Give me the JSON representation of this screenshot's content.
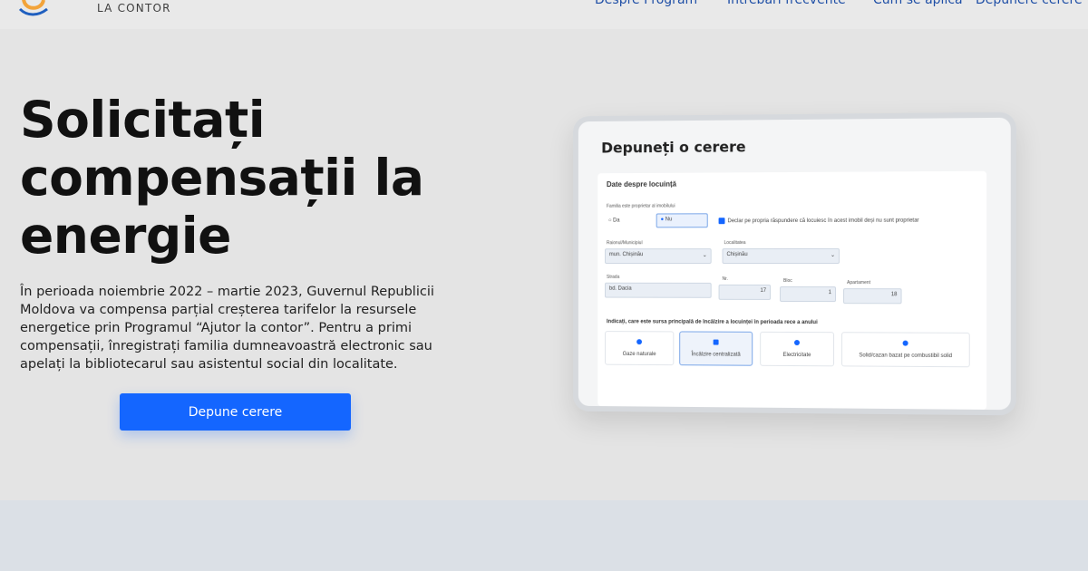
{
  "brand": {
    "logo_text": "LA CONTOR"
  },
  "nav": {
    "items": [
      "Despre Program",
      "Întrebări frecvente",
      "Cum se aplică",
      "Depunere cerere"
    ]
  },
  "hero": {
    "title": "Solicitați compensații la energie",
    "intro": "În perioada noiembrie 2022 – martie 2023, Guvernul Republicii Moldova va compensa parțial creșterea tarifelor la resursele energetice prin Programul “Ajutor la contor”. Pentru a primi compensații, înregistrați familia dumneavoastră electronic sau apelați la bibliotecarul sau asistentul social din localitate.",
    "cta_label": "Depune cerere"
  },
  "mockup": {
    "title": "Depuneți o cerere",
    "section_title": "Date despre locuință",
    "owner_question": "Familia este proprietar al imobilului",
    "owner_yes": "Da",
    "owner_no": "Nu",
    "declaration": "Declar pe propria răspundere că locuiesc în acest imobil deși nu sunt proprietar",
    "raion_label": "Raionul/Municipiul",
    "raion_value": "mun. Chișinău",
    "localitate_label": "Localitatea",
    "localitate_value": "Chișinău",
    "strada_label": "Strada",
    "strada_value": "bd. Dacia",
    "nr_label": "Nr.",
    "nr_value": "17",
    "bloc_label": "Bloc",
    "bloc_value": "1",
    "apartament_label": "Apartament",
    "apartament_value": "18",
    "heating_question": "Indicați, care este sursa principală de încălzire a locuinței în perioada rece a anului",
    "options": [
      "Gaze naturale",
      "Încălzire centralizată",
      "Electricitate",
      "Solid/cazan bazat pe combustibil solid"
    ]
  }
}
